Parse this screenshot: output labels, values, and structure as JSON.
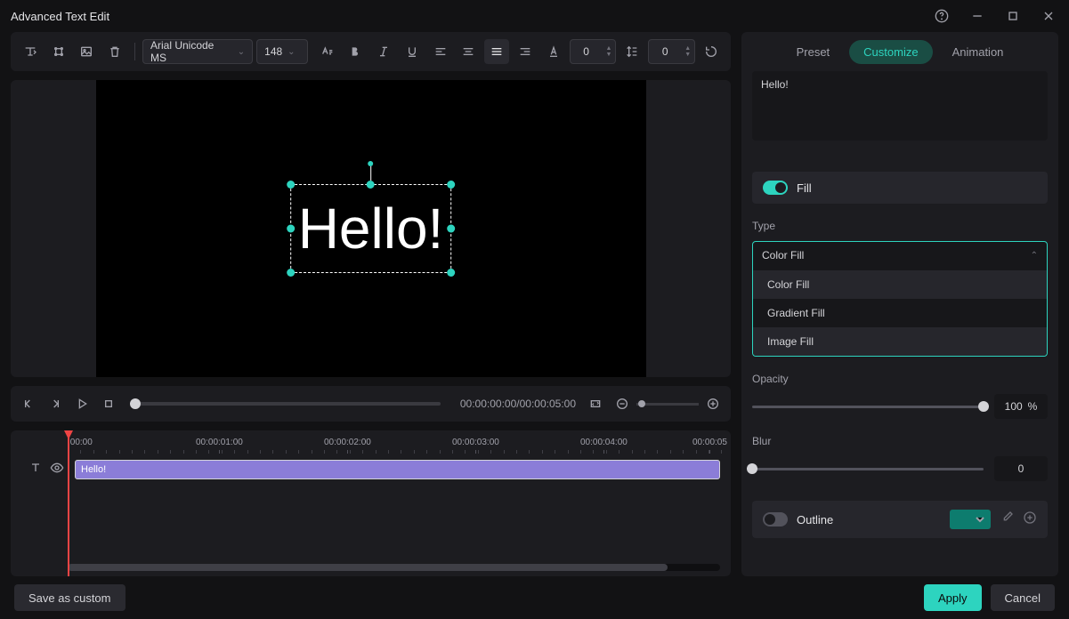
{
  "titlebar": {
    "title": "Advanced Text Edit"
  },
  "toolbar": {
    "font": "Arial Unicode MS",
    "size": "148",
    "charSpacing": "0",
    "lineSpacing": "0"
  },
  "preview": {
    "text": "Hello!"
  },
  "playback": {
    "time": "00:00:00:00/00:00:05:00"
  },
  "timeline": {
    "ticks": [
      ":00:00",
      "00:00:01:00",
      "00:00:02:00",
      "00:00:03:00",
      "00:00:04:00",
      "00:00:05"
    ],
    "clipLabel": "Hello!"
  },
  "panel": {
    "tabs": {
      "preset": "Preset",
      "customize": "Customize",
      "animation": "Animation"
    },
    "textValue": "Hello!",
    "fill": {
      "label": "Fill",
      "typeLabel": "Type",
      "selected": "Color Fill",
      "options": [
        "Color Fill",
        "Gradient Fill",
        "Image Fill"
      ]
    },
    "opacity": {
      "label": "Opacity",
      "value": "100",
      "unit": "%"
    },
    "blur": {
      "label": "Blur",
      "value": "0"
    },
    "outline": {
      "label": "Outline",
      "color": "#0d7c6e"
    }
  },
  "footer": {
    "saveCustom": "Save as custom",
    "apply": "Apply",
    "cancel": "Cancel"
  }
}
